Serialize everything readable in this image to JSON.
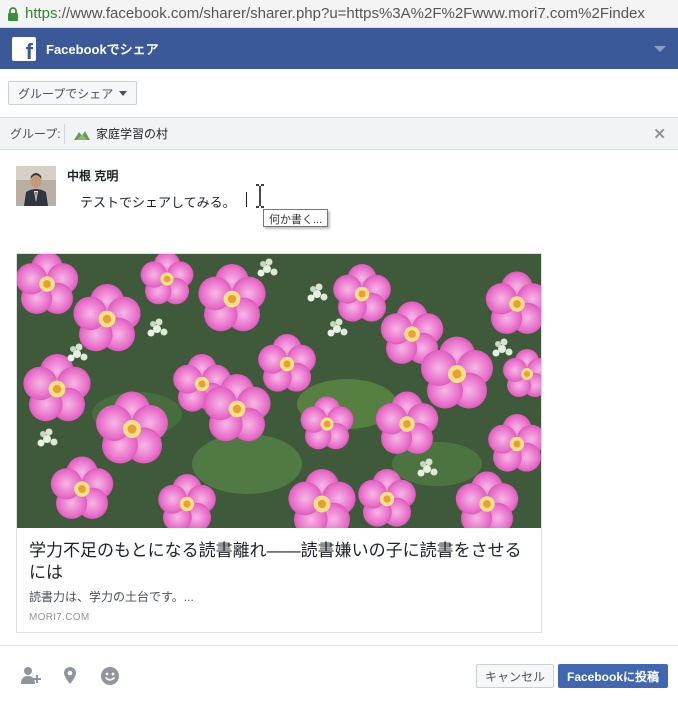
{
  "browser": {
    "url_scheme": "https",
    "url_rest": "://www.facebook.com/sharer/sharer.php?u=https%3A%2F%2Fwww.mori7.com%2Findex"
  },
  "header": {
    "logo_letter": "f",
    "title": "Facebookでシェア"
  },
  "share_target": {
    "label": "グループでシェア"
  },
  "group": {
    "label": "グループ:",
    "name": "家庭学習の村"
  },
  "composer": {
    "user_name": "中根 克明",
    "message": "テストでシェアしてみる。",
    "tooltip": "何か書く..."
  },
  "link_preview": {
    "title": "学力不足のもとになる読書離れ――読書嫌いの子に読書をさせるには",
    "description": "読書力は、学力の土台です。...",
    "domain": "MORI7.COM"
  },
  "footer": {
    "cancel_label": "キャンセル",
    "post_label": "Facebookに投稿",
    "icons": [
      "tag-friends-icon",
      "location-pin-icon",
      "feeling-smiley-icon"
    ]
  },
  "colors": {
    "facebook_blue": "#3b5998",
    "post_button": "#4267b2"
  }
}
